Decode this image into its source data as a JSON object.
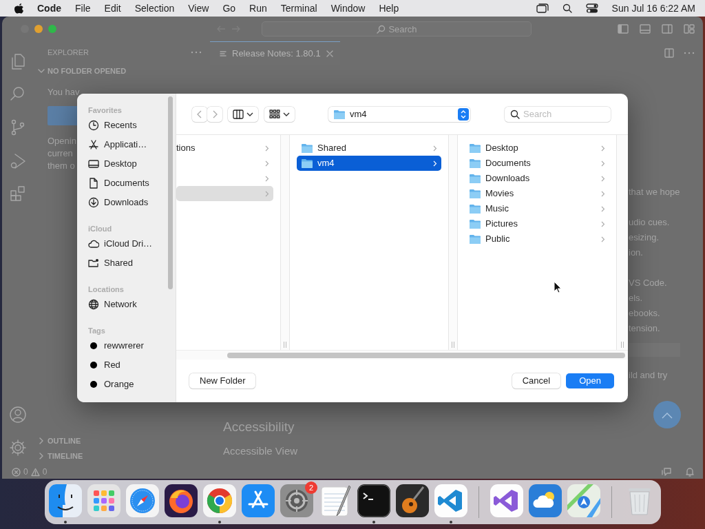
{
  "menu_bar": {
    "app": "Code",
    "items": [
      "File",
      "Edit",
      "Selection",
      "View",
      "Go",
      "Run",
      "Terminal",
      "Window",
      "Help"
    ],
    "clock": "Sun Jul 16 6:22 AM"
  },
  "title_bar": {
    "search_placeholder": "Search"
  },
  "explorer": {
    "title": "EXPLORER",
    "section": "NO FOLDER OPENED",
    "section_expanded": true,
    "intro": "You hav",
    "paragraph_lines": [
      "Openin",
      "curren",
      "them o"
    ],
    "panels": [
      {
        "label": "OUTLINE",
        "expanded": false
      },
      {
        "label": "TIMELINE",
        "expanded": false
      }
    ]
  },
  "tabs": [
    {
      "label": "Release Notes: 1.80.1",
      "selected": true
    }
  ],
  "editor": {
    "fragments": [
      {
        "kind": "text",
        "lines": [
          "that we hope"
        ]
      },
      {
        "kind": "text",
        "lines": [
          "udio cues.",
          "esizing.",
          "ion."
        ]
      },
      {
        "kind": "text",
        "lines": [
          "VS Code.",
          "els.",
          "ebooks.",
          "tension."
        ]
      },
      {
        "kind": "block"
      },
      {
        "kind": "text",
        "lines": [
          "ild and try"
        ]
      }
    ],
    "section_heading": "Accessibility",
    "subheading": "Accessible View"
  },
  "status_bar": {
    "errors": "0",
    "warnings": "0"
  },
  "dialog": {
    "sidebar": [
      {
        "heading": "Favorites",
        "items": [
          {
            "label": "Recents",
            "kind": "clock"
          },
          {
            "label": "Applicati…",
            "kind": "apps"
          },
          {
            "label": "Desktop",
            "kind": "desktop"
          },
          {
            "label": "Documents",
            "kind": "document"
          },
          {
            "label": "Downloads",
            "kind": "download"
          }
        ]
      },
      {
        "heading": "iCloud",
        "items": [
          {
            "label": "iCloud Dri…",
            "kind": "cloud"
          },
          {
            "label": "Shared",
            "kind": "shared"
          }
        ]
      },
      {
        "heading": "Locations",
        "items": [
          {
            "label": "Network",
            "kind": "network"
          }
        ]
      },
      {
        "heading": "Tags",
        "items": [
          {
            "label": "rewwrerer",
            "kind": "tag"
          },
          {
            "label": "Red",
            "kind": "tag"
          },
          {
            "label": "Orange",
            "kind": "tag"
          }
        ]
      }
    ],
    "path": "vm4",
    "search_placeholder": "Search",
    "columns": [
      {
        "active": false,
        "rows": [
          {
            "label": "tions",
            "kind": "plain",
            "selected": false
          },
          {
            "kind": "plain",
            "selected": false
          },
          {
            "kind": "plain",
            "selected": false
          },
          {
            "kind": "plain",
            "selected": true
          }
        ]
      },
      {
        "active": true,
        "rows": [
          {
            "label": "Shared",
            "kind": "folder",
            "selected": false
          },
          {
            "label": "vm4",
            "kind": "folder",
            "selected": true
          }
        ]
      },
      {
        "rows": [
          {
            "label": "Desktop",
            "kind": "folder",
            "selected": false
          },
          {
            "label": "Documents",
            "kind": "folder",
            "selected": false
          },
          {
            "label": "Downloads",
            "kind": "folder",
            "selected": false
          },
          {
            "label": "Movies",
            "kind": "folder",
            "selected": false
          },
          {
            "label": "Music",
            "kind": "folder",
            "selected": false
          },
          {
            "label": "Pictures",
            "kind": "folder",
            "selected": false
          },
          {
            "label": "Public",
            "kind": "folder",
            "selected": false
          }
        ]
      }
    ],
    "left_buttons": [
      {
        "label": "New Folder",
        "kind": "plain"
      }
    ],
    "right_buttons": [
      {
        "label": "Cancel",
        "kind": "plain"
      },
      {
        "label": "Open",
        "kind": "primary"
      }
    ]
  },
  "dock": {
    "groups": [
      [
        {
          "kind": "finder",
          "running": true
        },
        {
          "kind": "launchpad",
          "running": false
        },
        {
          "kind": "safari",
          "running": false
        },
        {
          "kind": "firefox",
          "running": false
        },
        {
          "kind": "chrome",
          "running": true
        },
        {
          "kind": "appstore",
          "running": false
        },
        {
          "kind": "settings",
          "running": false,
          "badge": "2"
        },
        {
          "kind": "textedit",
          "running": false
        },
        {
          "kind": "terminal",
          "running": true
        },
        {
          "kind": "garageband",
          "running": false
        },
        {
          "kind": "vscode",
          "running": true
        }
      ],
      [
        {
          "kind": "visualstudio",
          "running": false
        },
        {
          "kind": "weather",
          "running": false
        },
        {
          "kind": "maps",
          "running": false
        }
      ],
      [
        {
          "kind": "trash",
          "running": false
        }
      ]
    ]
  }
}
